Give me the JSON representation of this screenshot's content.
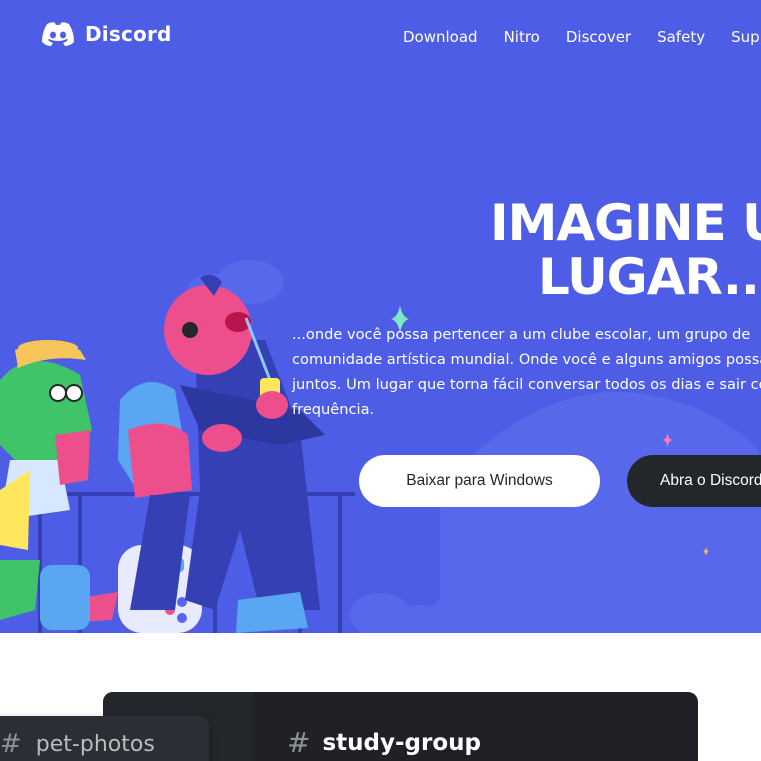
{
  "brand": {
    "name": "Discord"
  },
  "nav": {
    "items": [
      "Download",
      "Nitro",
      "Discover",
      "Safety",
      "Support"
    ]
  },
  "hero": {
    "headline_line1": "IMAGINE UM",
    "headline_line2": "LUGAR...",
    "description_lines": [
      "...onde você possa pertencer a um clube escolar, um grupo de",
      "comunidade artística mundial. Onde você e alguns amigos possam",
      "juntos. Um lugar que torna fácil conversar todos os dias e sair com",
      "frequência."
    ],
    "download_button": "Baixar para Windows",
    "open_button": "Abra o Discord no seu navegador"
  },
  "preview": {
    "hash_icon": "#",
    "main_channel": "study-group",
    "side_channel": "pet-photos"
  },
  "colors": {
    "hero_bg": "#4e5de6",
    "dark": "#23272a",
    "white": "#ffffff"
  }
}
